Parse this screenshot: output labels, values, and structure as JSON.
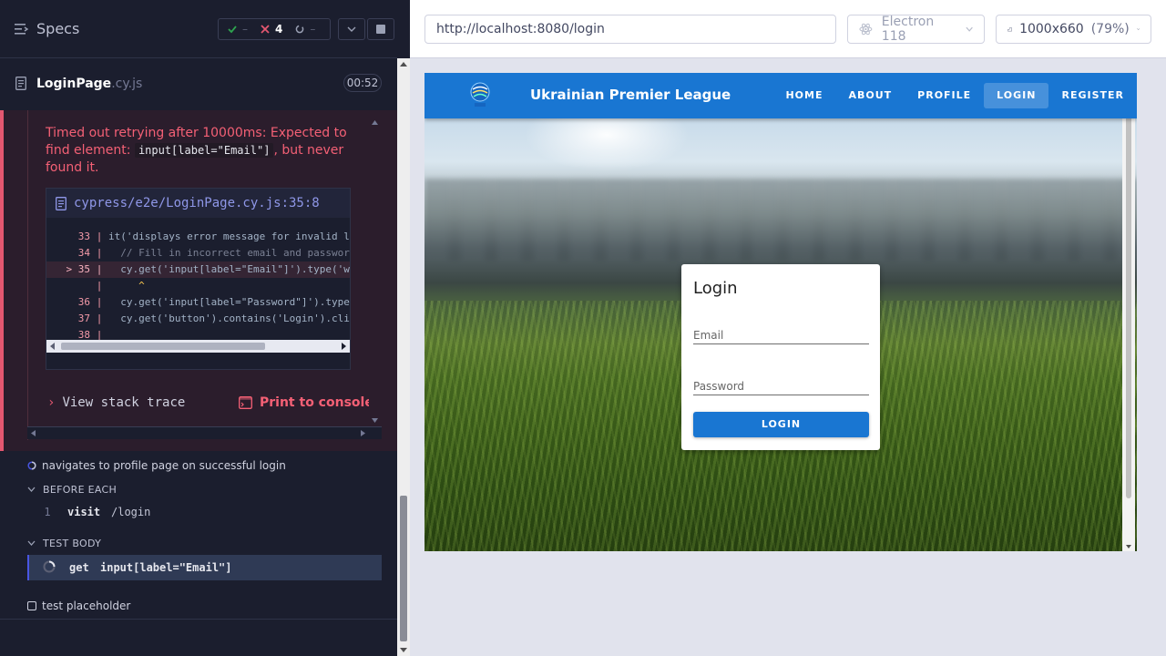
{
  "reporter": {
    "specs_label": "Specs",
    "stats": {
      "passed": "–",
      "failed": "4",
      "pending": "–"
    },
    "spec": {
      "name": "LoginPage",
      "ext": ".cy.js",
      "duration": "00:52"
    },
    "error": {
      "message_before": "Timed out retrying after 10000ms: Expected to find element: ",
      "selector": "input[label=\"Email\"]",
      "message_after": ", but never found it.",
      "file_link": "cypress/e2e/LoginPage.cy.js:35:8",
      "code_lines": [
        {
          "num": "33",
          "marker": " ",
          "code": "it('displays error message for invalid lo"
        },
        {
          "num": "34",
          "marker": " ",
          "code": "  // Fill in incorrect email and password"
        },
        {
          "num": "35",
          "marker": ">",
          "code": "  cy.get('input[label=\"Email\"]').type('wr"
        },
        {
          "num": "",
          "marker": " ",
          "code": "     ^"
        },
        {
          "num": "36",
          "marker": " ",
          "code": "  cy.get('input[label=\"Password\"]').type("
        },
        {
          "num": "37",
          "marker": " ",
          "code": "  cy.get('button').contains('Login').clic"
        },
        {
          "num": "38",
          "marker": " ",
          "code": ""
        }
      ],
      "stack_trace_label": "View stack trace",
      "print_label": "Print to console"
    },
    "running_test": "navigates to profile page on successful login",
    "before_each": {
      "label": "BEFORE EACH",
      "command": {
        "num": "1",
        "name": "visit",
        "message": "/login"
      }
    },
    "test_body": {
      "label": "TEST BODY",
      "command": {
        "name": "get",
        "message": "input[label=\"Email\"]"
      }
    },
    "placeholder_test": "test placeholder"
  },
  "aut": {
    "url": "http://localhost:8080/login",
    "browser": "Electron 118",
    "viewport": "1000x660",
    "scale": "(79%)"
  },
  "app": {
    "brand": "Ukrainian Premier League",
    "nav": [
      "HOME",
      "ABOUT",
      "PROFILE",
      "LOGIN",
      "REGISTER"
    ],
    "active_nav": "LOGIN",
    "login": {
      "title": "Login",
      "email_placeholder": "Email",
      "password_placeholder": "Password",
      "button": "LOGIN"
    }
  },
  "colors": {
    "reporter_bg": "#1b1e2e",
    "error_accent": "#e45770",
    "app_bar": "#1976d2",
    "aut_bg": "#e1e3ed"
  }
}
